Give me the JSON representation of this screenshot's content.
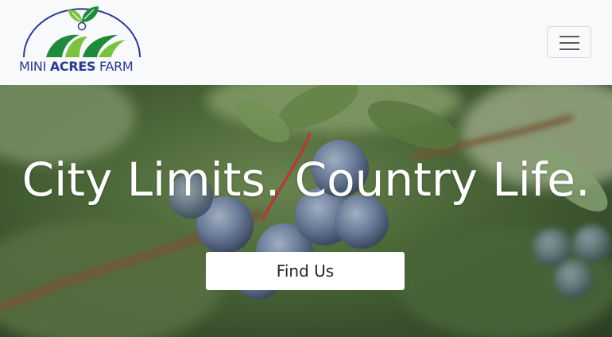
{
  "brand": {
    "name_prefix": "MINI ",
    "name_bold": "ACRES",
    "name_suffix": " FARM",
    "colors": {
      "navy": "#2b3a8f",
      "green_dark": "#1f8a3b",
      "green_light": "#7cc242"
    }
  },
  "navbar": {
    "toggler_icon": "hamburger-icon"
  },
  "hero": {
    "headline": "City Limits. Country Life.",
    "cta_label": "Find Us",
    "background_subject": "blueberries-on-branch"
  }
}
